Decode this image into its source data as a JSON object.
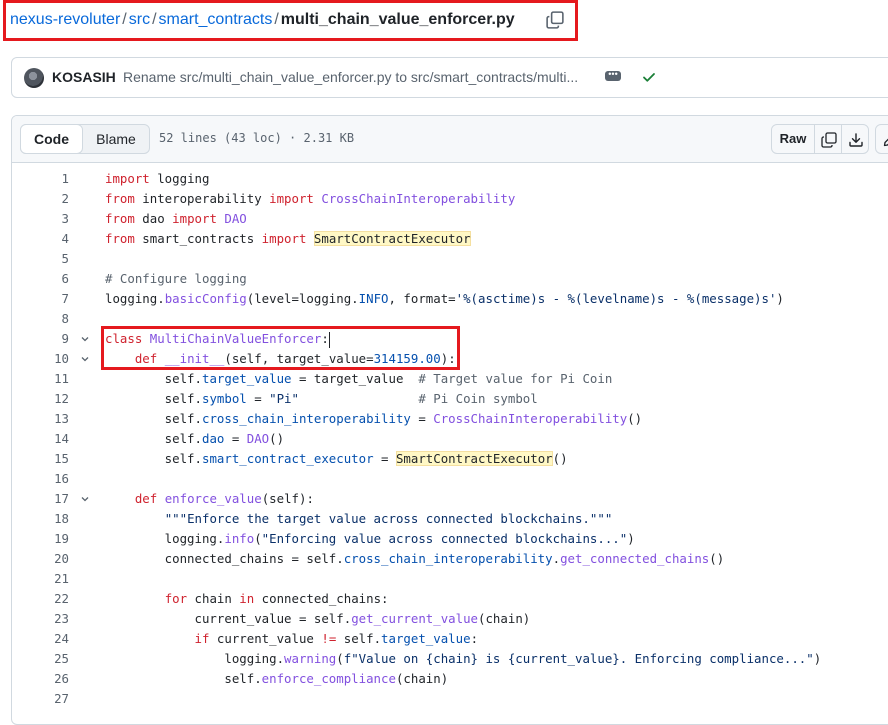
{
  "breadcrumb": {
    "owner": "nexus-revoluter",
    "sep": "/",
    "dir1": "src",
    "dir2": "smart_contracts",
    "file": "multi_chain_value_enforcer.py"
  },
  "commit": {
    "author": "KOSASIH",
    "message": "Rename src/multi_chain_value_enforcer.py to src/smart_contracts/multi...",
    "more": "•••"
  },
  "file_header": {
    "tab_code": "Code",
    "tab_blame": "Blame",
    "meta": "52 lines (43 loc) · 2.31 KB",
    "raw_label": "Raw"
  },
  "code_lines": [
    {
      "n": "1",
      "parts": [
        [
          "kw",
          "import"
        ],
        [
          "t",
          " logging"
        ]
      ]
    },
    {
      "n": "2",
      "parts": [
        [
          "kw",
          "from"
        ],
        [
          "t",
          " interoperability "
        ],
        [
          "kw",
          "import"
        ],
        [
          "t",
          " "
        ],
        [
          "cls",
          "CrossChainInteroperability"
        ]
      ]
    },
    {
      "n": "3",
      "parts": [
        [
          "kw",
          "from"
        ],
        [
          "t",
          " dao "
        ],
        [
          "kw",
          "import"
        ],
        [
          "t",
          " "
        ],
        [
          "cls",
          "DAO"
        ]
      ]
    },
    {
      "n": "4",
      "parts": [
        [
          "kw",
          "from"
        ],
        [
          "t",
          " smart_contracts "
        ],
        [
          "kw",
          "import"
        ],
        [
          "t",
          " "
        ],
        [
          "hl",
          "SmartContractExecutor"
        ]
      ]
    },
    {
      "n": "5",
      "parts": []
    },
    {
      "n": "6",
      "parts": [
        [
          "cm",
          "# Configure logging"
        ]
      ]
    },
    {
      "n": "7",
      "parts": [
        [
          "t",
          "logging."
        ],
        [
          "fn",
          "basicConfig"
        ],
        [
          "t",
          "(level=logging."
        ],
        [
          "prop",
          "INFO"
        ],
        [
          "t",
          ", format="
        ],
        [
          "str",
          "'%(asctime)s - %(levelname)s - %(message)s'"
        ],
        [
          "t",
          ")"
        ]
      ]
    },
    {
      "n": "8",
      "parts": []
    },
    {
      "n": "9",
      "fold": true,
      "cursor": true,
      "parts": [
        [
          "kw",
          "class"
        ],
        [
          "t",
          " "
        ],
        [
          "cls",
          "MultiChainValueEnforcer"
        ],
        [
          "t",
          ":"
        ]
      ]
    },
    {
      "n": "10",
      "fold": true,
      "parts": [
        [
          "t",
          "    "
        ],
        [
          "kw",
          "def"
        ],
        [
          "t",
          " "
        ],
        [
          "fn",
          "__init__"
        ],
        [
          "t",
          "(self, target_value="
        ],
        [
          "num",
          "314159.00"
        ],
        [
          "t",
          "):"
        ]
      ]
    },
    {
      "n": "11",
      "parts": [
        [
          "t",
          "        self."
        ],
        [
          "prop",
          "target_value"
        ],
        [
          "t",
          " = target_value  "
        ],
        [
          "cm",
          "# Target value for Pi Coin"
        ]
      ]
    },
    {
      "n": "12",
      "parts": [
        [
          "t",
          "        self."
        ],
        [
          "prop",
          "symbol"
        ],
        [
          "t",
          " = "
        ],
        [
          "str",
          "\"Pi\""
        ],
        [
          "t",
          "                "
        ],
        [
          "cm",
          "# Pi Coin symbol"
        ]
      ]
    },
    {
      "n": "13",
      "parts": [
        [
          "t",
          "        self."
        ],
        [
          "prop",
          "cross_chain_interoperability"
        ],
        [
          "t",
          " = "
        ],
        [
          "cls",
          "CrossChainInteroperability"
        ],
        [
          "t",
          "()"
        ]
      ]
    },
    {
      "n": "14",
      "parts": [
        [
          "t",
          "        self."
        ],
        [
          "prop",
          "dao"
        ],
        [
          "t",
          " = "
        ],
        [
          "cls",
          "DAO"
        ],
        [
          "t",
          "()"
        ]
      ]
    },
    {
      "n": "15",
      "parts": [
        [
          "t",
          "        self."
        ],
        [
          "prop",
          "smart_contract_executor"
        ],
        [
          "t",
          " = "
        ],
        [
          "hl",
          "SmartContractExecutor"
        ],
        [
          "t",
          "()"
        ]
      ]
    },
    {
      "n": "16",
      "parts": []
    },
    {
      "n": "17",
      "fold": true,
      "parts": [
        [
          "t",
          "    "
        ],
        [
          "kw",
          "def"
        ],
        [
          "t",
          " "
        ],
        [
          "fn",
          "enforce_value"
        ],
        [
          "t",
          "(self):"
        ]
      ]
    },
    {
      "n": "18",
      "parts": [
        [
          "t",
          "        "
        ],
        [
          "str",
          "\"\"\"Enforce the target value across connected blockchains.\"\"\""
        ]
      ]
    },
    {
      "n": "19",
      "parts": [
        [
          "t",
          "        logging."
        ],
        [
          "fn",
          "info"
        ],
        [
          "t",
          "("
        ],
        [
          "str",
          "\"Enforcing value across connected blockchains...\""
        ],
        [
          "t",
          ")"
        ]
      ]
    },
    {
      "n": "20",
      "parts": [
        [
          "t",
          "        connected_chains = self."
        ],
        [
          "prop",
          "cross_chain_interoperability"
        ],
        [
          "t",
          "."
        ],
        [
          "fn",
          "get_connected_chains"
        ],
        [
          "t",
          "()"
        ]
      ]
    },
    {
      "n": "21",
      "parts": []
    },
    {
      "n": "22",
      "parts": [
        [
          "t",
          "        "
        ],
        [
          "kw",
          "for"
        ],
        [
          "t",
          " chain "
        ],
        [
          "kw",
          "in"
        ],
        [
          "t",
          " connected_chains:"
        ]
      ]
    },
    {
      "n": "23",
      "parts": [
        [
          "t",
          "            current_value = self."
        ],
        [
          "fn",
          "get_current_value"
        ],
        [
          "t",
          "(chain)"
        ]
      ]
    },
    {
      "n": "24",
      "parts": [
        [
          "t",
          "            "
        ],
        [
          "kw",
          "if"
        ],
        [
          "t",
          " current_value "
        ],
        [
          "kw",
          "!="
        ],
        [
          "t",
          " self."
        ],
        [
          "prop",
          "target_value"
        ],
        [
          "t",
          ":"
        ]
      ]
    },
    {
      "n": "25",
      "parts": [
        [
          "t",
          "                logging."
        ],
        [
          "fn",
          "warning"
        ],
        [
          "t",
          "("
        ],
        [
          "str",
          "f\"Value on {chain} is {current_value}. Enforcing compliance...\""
        ],
        [
          "t",
          ")"
        ]
      ]
    },
    {
      "n": "26",
      "parts": [
        [
          "t",
          "                self."
        ],
        [
          "fn",
          "enforce_compliance"
        ],
        [
          "t",
          "(chain)"
        ]
      ]
    },
    {
      "n": "27",
      "parts": []
    }
  ]
}
